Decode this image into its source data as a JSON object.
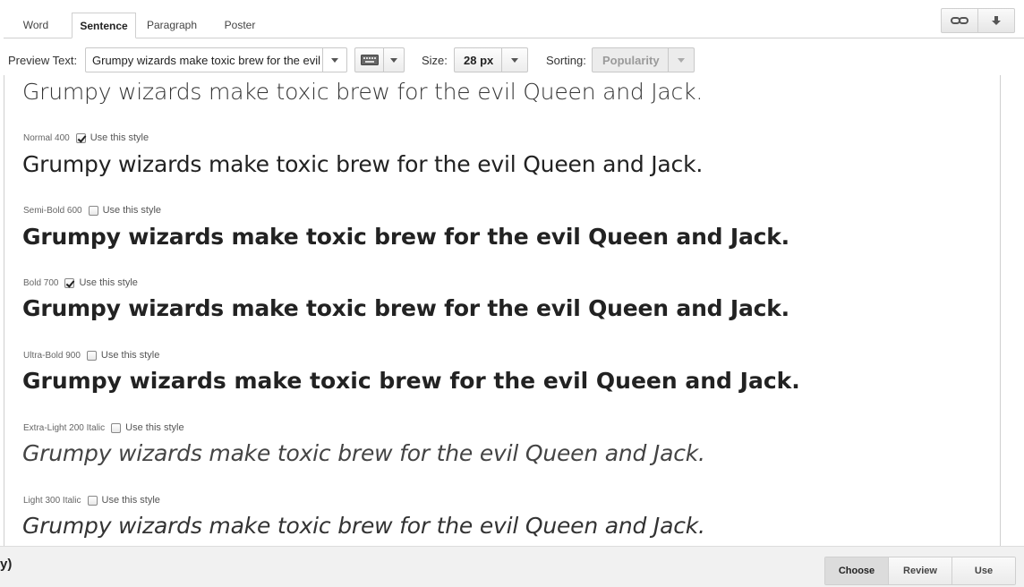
{
  "tabs": [
    {
      "label": "Word",
      "active": false
    },
    {
      "label": "Sentence",
      "active": true
    },
    {
      "label": "Paragraph",
      "active": false
    },
    {
      "label": "Poster",
      "active": false
    }
  ],
  "top_buttons": [
    {
      "icon": "link-icon"
    },
    {
      "icon": "download-arrow-icon"
    }
  ],
  "toolbar": {
    "preview_text_label": "Preview Text:",
    "preview_text_value": "Grumpy wizards make toxic brew for the evil",
    "keyboard_icon": "keyboard-icon",
    "size_label": "Size:",
    "size_value": "28 px",
    "sorting_label": "Sorting:",
    "sorting_value": "Popularity"
  },
  "sample_text": "Grumpy wizards make toxic brew for the evil Queen and Jack.",
  "use_style_label": "Use this style",
  "styles": [
    {
      "name": "",
      "weight": 300,
      "italic": false,
      "checked": null
    },
    {
      "name": "Normal 400",
      "weight": 400,
      "italic": false,
      "checked": true
    },
    {
      "name": "Semi-Bold 600",
      "weight": 600,
      "italic": false,
      "checked": false
    },
    {
      "name": "Bold 700",
      "weight": 700,
      "italic": false,
      "checked": true
    },
    {
      "name": "Ultra-Bold 900",
      "weight": 900,
      "italic": false,
      "checked": false
    },
    {
      "name": "Extra-Light 200 Italic",
      "weight": 200,
      "italic": true,
      "checked": false
    },
    {
      "name": "Light 300 Italic",
      "weight": 300,
      "italic": true,
      "checked": false
    }
  ],
  "footer": {
    "stub_text": "y)",
    "steps": [
      {
        "label": "Choose",
        "active": true
      },
      {
        "label": "Review",
        "active": false
      },
      {
        "label": "Use",
        "active": false
      }
    ]
  }
}
